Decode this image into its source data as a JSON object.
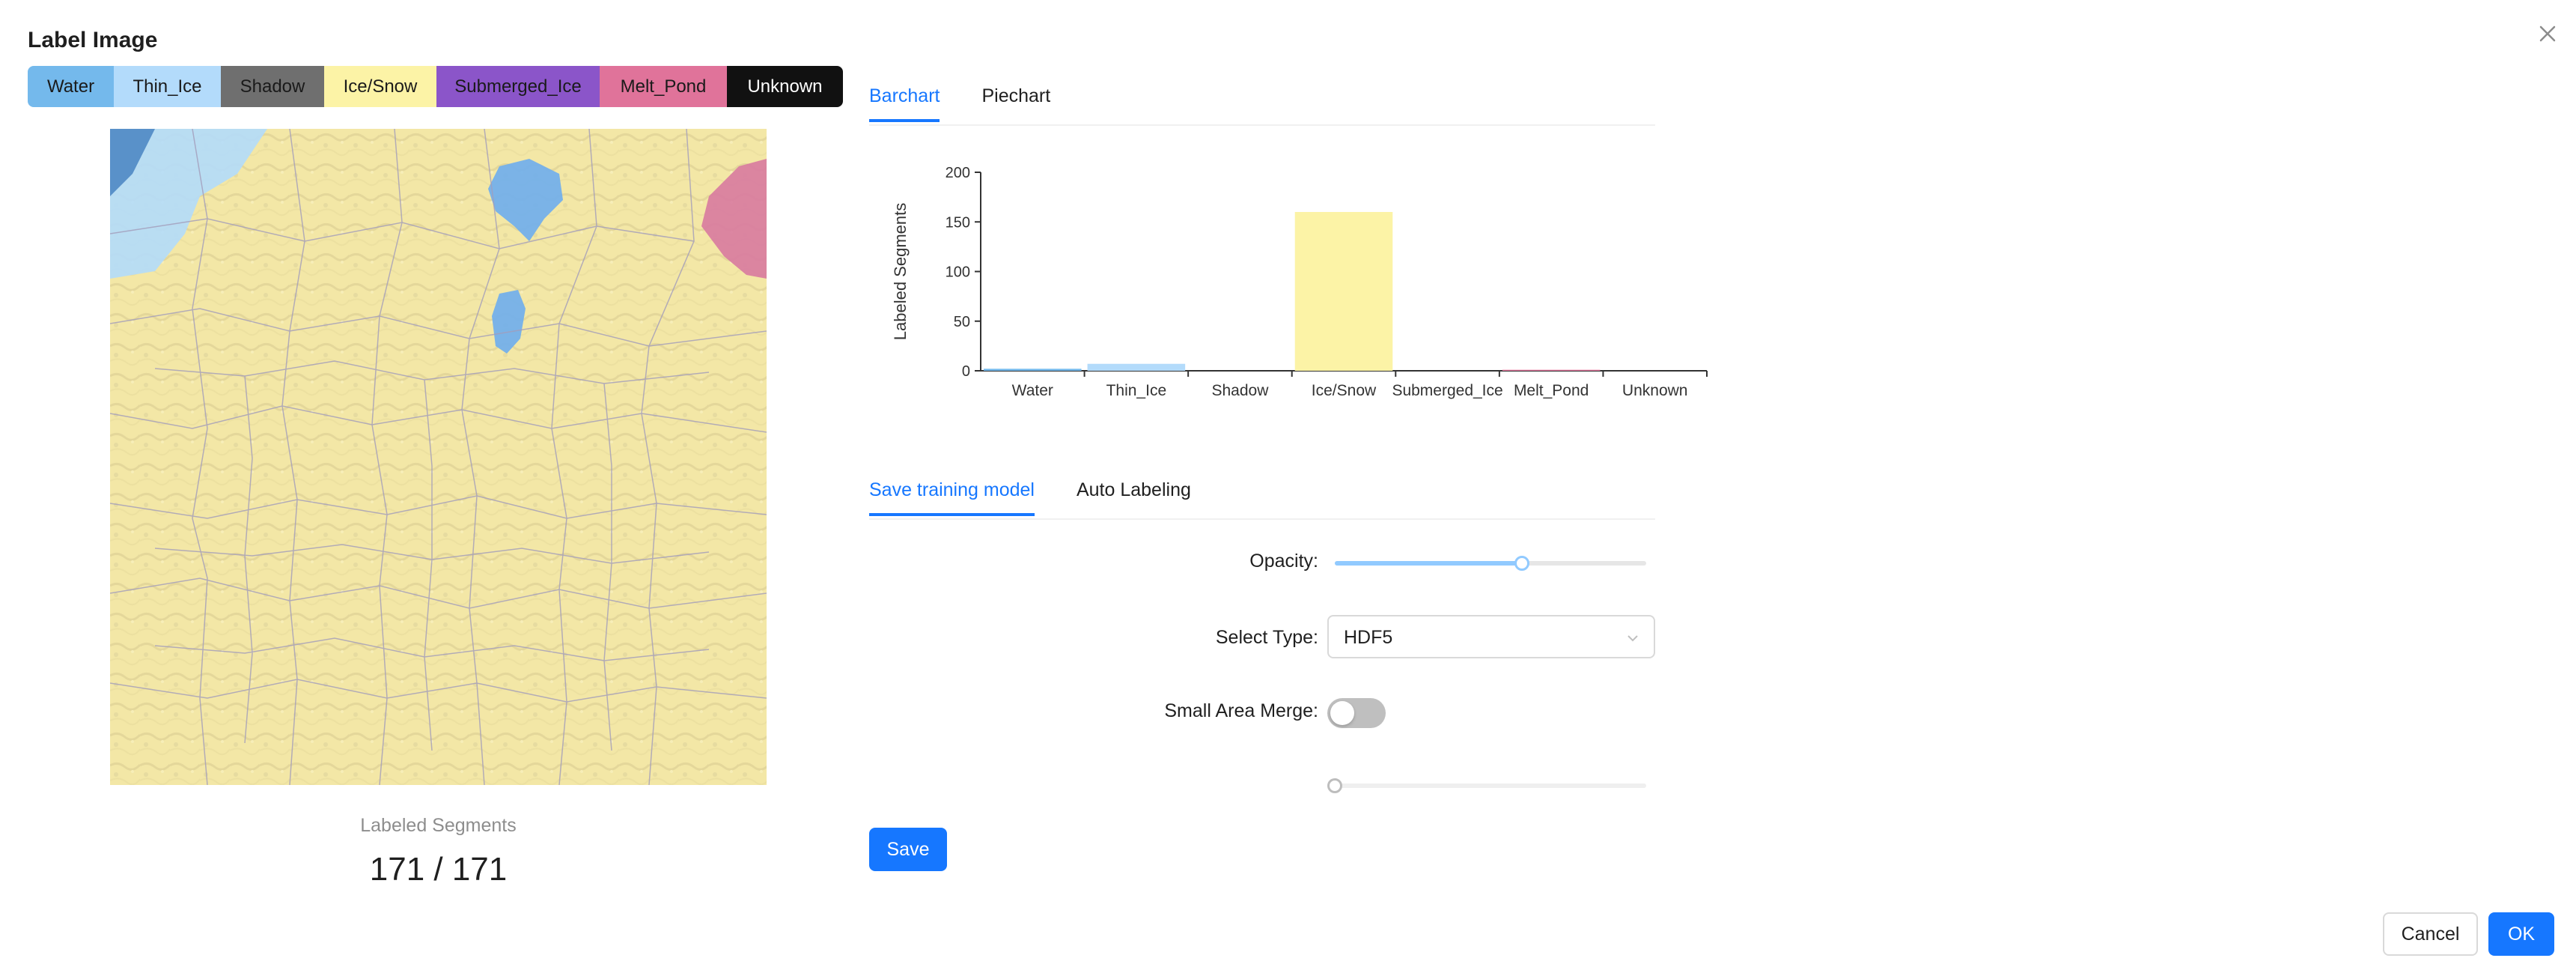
{
  "dialog": {
    "title": "Label Image"
  },
  "labels": [
    {
      "name": "Water",
      "bg": "#74b9ec",
      "fg": "#1a1a1a"
    },
    {
      "name": "Thin_Ice",
      "bg": "#b3dbfb",
      "fg": "#1a1a1a"
    },
    {
      "name": "Shadow",
      "bg": "#6f6f6f",
      "fg": "#1a1a1a"
    },
    {
      "name": "Ice/Snow",
      "bg": "#fcf3a6",
      "fg": "#1a1a1a"
    },
    {
      "name": "Submerged_Ice",
      "bg": "#8b55c9",
      "fg": "#1a1a1a"
    },
    {
      "name": "Melt_Pond",
      "bg": "#e0739a",
      "fg": "#1a1a1a"
    },
    {
      "name": "Unknown",
      "bg": "#111111",
      "fg": "#ffffff"
    }
  ],
  "segments": {
    "caption": "Labeled Segments",
    "count": "171 / 171"
  },
  "chart_tabs": [
    {
      "label": "Barchart",
      "active": true
    },
    {
      "label": "Piechart",
      "active": false
    }
  ],
  "chart_data": {
    "type": "bar",
    "categories": [
      "Water",
      "Thin_Ice",
      "Shadow",
      "Ice/Snow",
      "Submerged_Ice",
      "Melt_Pond",
      "Unknown"
    ],
    "values": [
      2,
      7,
      0,
      160,
      0,
      1,
      0
    ],
    "colors": [
      "#74b9ec",
      "#b3dbfb",
      "#6f6f6f",
      "#fcf3a6",
      "#8b55c9",
      "#e0739a",
      "#111111"
    ],
    "ylabel": "Labeled Segments",
    "ylim": [
      0,
      200
    ],
    "yticks": [
      0,
      50,
      100,
      150,
      200
    ]
  },
  "tool_tabs": [
    {
      "label": "Save training model",
      "active": true
    },
    {
      "label": "Auto Labeling",
      "active": false
    }
  ],
  "form": {
    "opacity_label": "Opacity:",
    "opacity_value": 0.6,
    "select_type_label": "Select Type:",
    "select_type_value": "HDF5",
    "small_area_merge_label": "Small Area Merge:",
    "small_area_merge_on": false,
    "merge_slider_value": 0,
    "save_label": "Save"
  },
  "footer": {
    "cancel_label": "Cancel",
    "ok_label": "OK"
  },
  "icons": {
    "close": "close-icon",
    "select_arrow": "chevron-down-icon"
  }
}
